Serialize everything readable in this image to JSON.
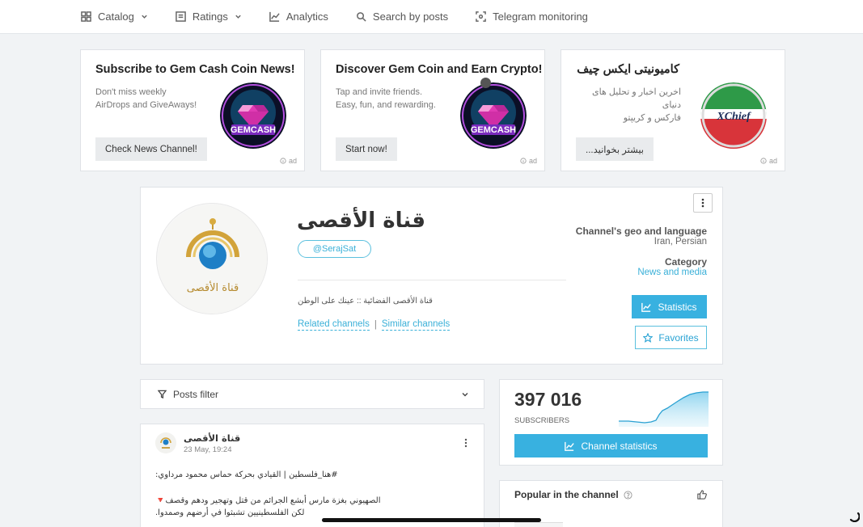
{
  "nav": {
    "items": [
      {
        "label": "Catalog",
        "icon": "grid-icon",
        "dropdown": true
      },
      {
        "label": "Ratings",
        "icon": "list-icon",
        "dropdown": true
      },
      {
        "label": "Analytics",
        "icon": "line-chart-icon",
        "dropdown": false
      },
      {
        "label": "Search by posts",
        "icon": "search-icon",
        "dropdown": false
      },
      {
        "label": "Telegram monitoring",
        "icon": "monitor-icon",
        "dropdown": false
      }
    ]
  },
  "ads": [
    {
      "title": "Subscribe to Gem Cash Coin News!",
      "desc": "Don't miss weekly\nAirDrops and GiveAways!",
      "button": "Check News Channel!",
      "logo_text": "GEMCASH",
      "mark": "ad"
    },
    {
      "title": "Discover Gem Coin and Earn Crypto!",
      "desc": "Tap and invite friends.\nEasy, fun, and rewarding.",
      "button": "Start now!",
      "logo_text": "GEMCASH",
      "mark": "ad"
    },
    {
      "title": "کامیونیتی ایکس چیف",
      "desc": "اخرین اخبار و تحلیل های دنیای\nفارکس و کریپتو",
      "button": "بیشتر بخوانید...",
      "logo_text": "XChief",
      "mark": "ad"
    }
  ],
  "channel": {
    "title": "قناة الأقصى",
    "handle": "@SerajSat",
    "description": "قناة الأقصى الفضائية :: عينك على الوطن",
    "avatar_text": "قناة الأقصى",
    "related_link": "Related channels",
    "separator": "|",
    "similar_link": "Similar channels",
    "geo_label": "Channel's geo and language",
    "geo_value": "Iran, Persian",
    "category_label": "Category",
    "category_value": "News and media",
    "statistics_button": "Statistics",
    "favorites_button": "Favorites"
  },
  "filter": {
    "label": "Posts filter"
  },
  "post": {
    "author": "قناة الأقصى",
    "date": "23 May, 19:24",
    "lines": [
      "#هنا_فلسطين | القيادي بحركة حماس محمود مرداوي:",
      "الصهيوني بغزة مارس أبشع الجرائم من قتل وتهجير ودهم وقصف🔻",
      "لكن الفلسطينيين تشبثوا في أرضهم وصمدوا."
    ]
  },
  "stats": {
    "subscribers": "397 016",
    "subscribers_label": "SUBSCRIBERS",
    "button": "Channel statistics",
    "accent": "#38b1e0"
  },
  "popular": {
    "title": "Popular in the channel"
  }
}
